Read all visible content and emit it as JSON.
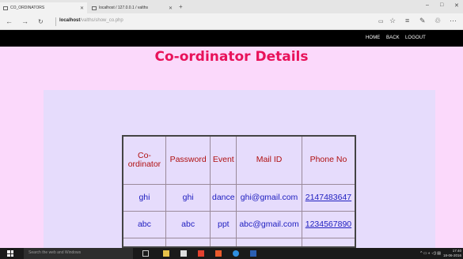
{
  "browser": {
    "tabs": [
      {
        "title": "CO_ORDINATORS",
        "active": true
      },
      {
        "title": "localhost / 127.0.0.1 / valths"
      }
    ],
    "new_tab": "+",
    "window_controls": [
      "–",
      "□",
      "✕"
    ],
    "address": {
      "host": "localhost",
      "path": "/valths/show_co.php"
    },
    "toolbar_icons": [
      "reading-view-icon",
      "favorite-star-icon",
      "hub-icon",
      "web-note-icon",
      "share-icon",
      "more-icon"
    ]
  },
  "site_nav": {
    "items": [
      "HOME",
      "BACK",
      "LOGOUT"
    ]
  },
  "page": {
    "title": "Co-ordinator Details"
  },
  "table": {
    "headers": [
      "Co-ordinator",
      "Password",
      "Event",
      "Mail ID",
      "Phone No"
    ],
    "rows": [
      [
        "ghi",
        "ghi",
        "dance",
        "ghi@gmail.com",
        "2147483647"
      ],
      [
        "abc",
        "abc",
        "ppt",
        "abc@gmail.com",
        "1234567890"
      ],
      [
        "",
        "",
        "",
        "",
        ""
      ]
    ]
  },
  "taskbar": {
    "search_placeholder": "Search the web and Windows",
    "apps": [
      "task-view-icon",
      "file-explorer-icon",
      "store-icon",
      "mail-icon",
      "office-icon",
      "edge-icon",
      "word-icon"
    ],
    "clock_time": "17:40",
    "clock_date": "18-06-2016",
    "colors": {
      "taskbar_bg": "#1a1a1a",
      "nav_bg": "#000000",
      "title": "#e8125a",
      "page_bg": "#fbd9fb",
      "panel_bg": "#e6dcfc"
    }
  }
}
